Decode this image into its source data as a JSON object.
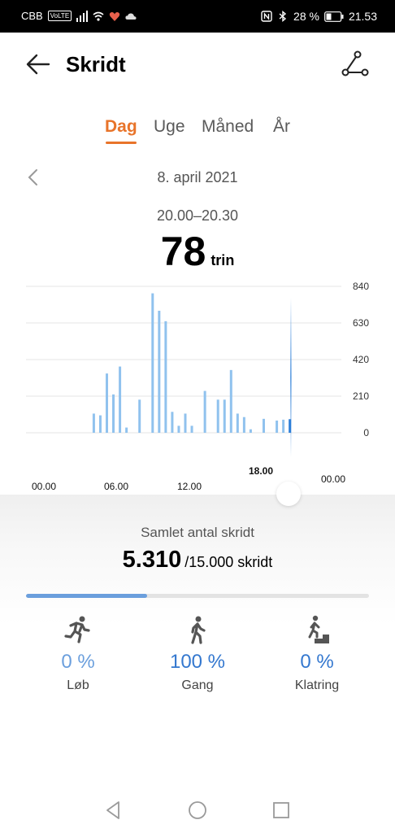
{
  "status_bar": {
    "carrier": "CBB",
    "volte": "VoLTE",
    "battery": "28 %",
    "time": "21.53"
  },
  "header": {
    "title": "Skridt",
    "back_icon": "arrow-left-icon",
    "share_icon": "route-share-icon"
  },
  "tabs": [
    {
      "label": "Dag",
      "active": true
    },
    {
      "label": "Uge",
      "active": false
    },
    {
      "label": "Måned",
      "active": false
    },
    {
      "label": "År",
      "active": false
    }
  ],
  "date": {
    "label": "8. april 2021",
    "prev_icon": "chevron-left-icon"
  },
  "selection": {
    "range": "20.00–20.30",
    "value": "78",
    "unit": "trin"
  },
  "chart_data": {
    "type": "bar",
    "x": [
      "05.00",
      "05.30",
      "06.00",
      "06.30",
      "07.00",
      "07.30",
      "08.30",
      "09.30",
      "10.00",
      "10.30",
      "11.00",
      "11.30",
      "12.00",
      "12.30",
      "13.30",
      "14.30",
      "15.00",
      "15.30",
      "16.00",
      "16.30",
      "17.00",
      "18.00",
      "19.00",
      "19.30",
      "20.00"
    ],
    "values": [
      110,
      100,
      340,
      220,
      380,
      30,
      190,
      800,
      700,
      640,
      120,
      40,
      110,
      40,
      240,
      190,
      190,
      360,
      110,
      90,
      20,
      80,
      70,
      75,
      78
    ],
    "selected_index": 24,
    "ylim": [
      0,
      840
    ],
    "y_ticks": [
      "840",
      "630",
      "420",
      "210",
      "0"
    ],
    "x_ticks": [
      "00.00",
      "06.00",
      "12.00",
      "18.00",
      "00.00"
    ],
    "highlight_tick": "18.00",
    "colors": {
      "bar": "#90c2ee",
      "selected": "#2d7fd8",
      "grid": "#e6e6e6"
    }
  },
  "summary": {
    "label": "Samlet antal skridt",
    "total": "5.310",
    "goal": "/15.000 skridt",
    "progress": 0.354
  },
  "activities": [
    {
      "icon": "running-icon",
      "percent": "0 %",
      "label": "Løb"
    },
    {
      "icon": "walking-icon",
      "percent": "100 %",
      "label": "Gang"
    },
    {
      "icon": "climbing-icon",
      "percent": "0 %",
      "label": "Klatring"
    }
  ],
  "colors": {
    "accent": "#e8742a",
    "blue": "#6b9fdd"
  }
}
